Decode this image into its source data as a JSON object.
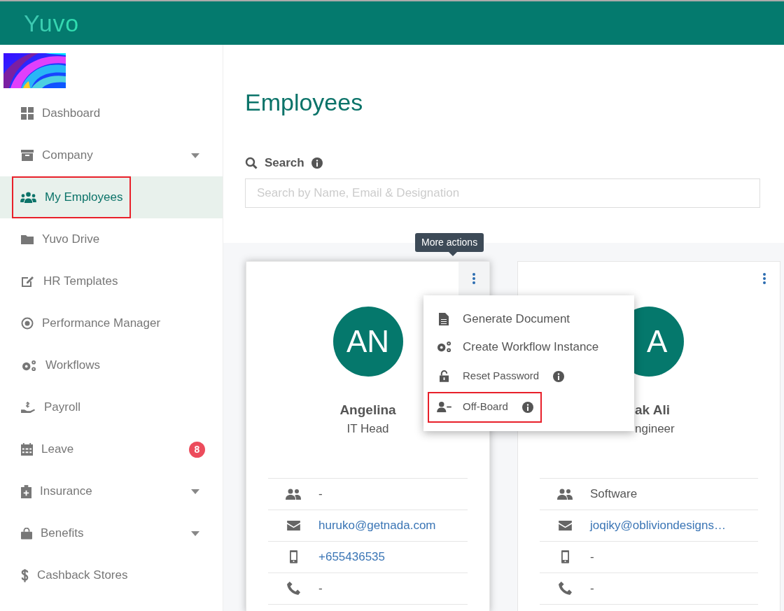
{
  "header": {
    "logo": "Yuvo"
  },
  "sidebar": {
    "items": [
      {
        "label": "Dashboard",
        "selected": false,
        "annotated": false,
        "expandable": false
      },
      {
        "label": "Company",
        "selected": false,
        "annotated": false,
        "expandable": true
      },
      {
        "label": "My Employees",
        "selected": true,
        "annotated": true,
        "expandable": false
      },
      {
        "label": "Yuvo Drive",
        "selected": false,
        "annotated": false,
        "expandable": false
      },
      {
        "label": "HR Templates",
        "selected": false,
        "annotated": false,
        "expandable": false
      },
      {
        "label": "Performance Manager",
        "selected": false,
        "annotated": false,
        "expandable": false
      },
      {
        "label": "Workflows",
        "selected": false,
        "annotated": false,
        "expandable": false
      },
      {
        "label": "Payroll",
        "selected": false,
        "annotated": false,
        "expandable": false
      },
      {
        "label": "Leave",
        "selected": false,
        "annotated": false,
        "expandable": false,
        "badge": "8"
      },
      {
        "label": "Insurance",
        "selected": false,
        "annotated": false,
        "expandable": true
      },
      {
        "label": "Benefits",
        "selected": false,
        "annotated": false,
        "expandable": true
      },
      {
        "label": "Cashback Stores",
        "selected": false,
        "annotated": false,
        "expandable": false
      }
    ]
  },
  "page": {
    "title": "Employees"
  },
  "search": {
    "label": "Search",
    "placeholder": "Search by Name, Email & Designation"
  },
  "tooltip": "More actions",
  "menu": {
    "items": [
      {
        "label": "Generate Document",
        "info": false,
        "annotated": false
      },
      {
        "label": "Create Workflow Instance",
        "info": false,
        "annotated": false
      },
      {
        "label": "Reset Password",
        "info": true,
        "annotated": false
      },
      {
        "label": "Off-Board",
        "info": true,
        "annotated": true
      }
    ]
  },
  "employees": [
    {
      "initials": "AN",
      "name": "Angelina",
      "designation": "IT Head",
      "covered_by_menu": false,
      "menu_open": true,
      "details": [
        {
          "kind": "department",
          "value": "-",
          "link": false
        },
        {
          "kind": "email",
          "value": "huruko@getnada.com",
          "link": true
        },
        {
          "kind": "mobile",
          "value": "+655436535",
          "link": true
        },
        {
          "kind": "phone",
          "value": "-",
          "link": false
        }
      ]
    },
    {
      "initials": "A",
      "name": "ak Ali",
      "designation": "ngineer",
      "covered_by_menu": true,
      "menu_open": false,
      "details": [
        {
          "kind": "department",
          "value": "Software",
          "link": false
        },
        {
          "kind": "email",
          "value": "joqiky@obliviondesigns…",
          "link": true
        },
        {
          "kind": "mobile",
          "value": "-",
          "link": false
        },
        {
          "kind": "phone",
          "value": "-",
          "link": false
        }
      ]
    }
  ]
}
